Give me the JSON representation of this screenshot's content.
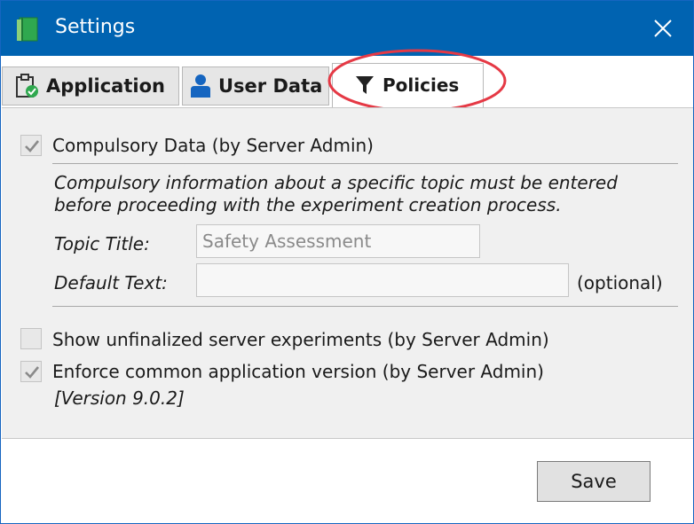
{
  "window": {
    "title": "Settings",
    "accent_color": "#0063b1",
    "icons": {
      "app": "green-book-icon",
      "close": "close-icon"
    }
  },
  "tabs": [
    {
      "label": "Application",
      "icon": "clipboard-check-icon",
      "active": false
    },
    {
      "label": "User Data",
      "icon": "user-icon",
      "active": false
    },
    {
      "label": "Policies",
      "icon": "filter-icon",
      "active": true
    }
  ],
  "annotation": {
    "shape": "ellipse",
    "color": "#e53945"
  },
  "policies": {
    "compulsory": {
      "checked": true,
      "label": "Compulsory Data (by Server Admin)",
      "description_line1": "Compulsory information about a specific topic must be entered",
      "description_line2": "before proceeding with the experiment creation process.",
      "topic_title_label": "Topic Title:",
      "topic_title_value": "Safety Assessment",
      "default_text_label": "Default Text:",
      "default_text_value": "",
      "optional_note": "(optional)"
    },
    "unfinalized": {
      "checked": false,
      "label": "Show unfinalized server experiments (by Server Admin)"
    },
    "enforce_version": {
      "checked": true,
      "label": "Enforce common application version (by Server Admin)",
      "version": "[Version 9.0.2]"
    }
  },
  "footer": {
    "save_label": "Save"
  }
}
